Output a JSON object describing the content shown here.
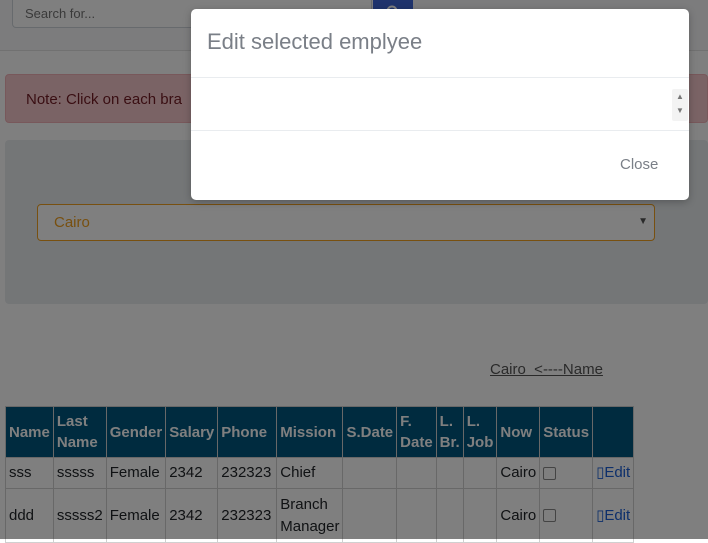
{
  "search": {
    "placeholder": "Search for..."
  },
  "note": {
    "text": "Note: Click on each bra"
  },
  "branch_select": {
    "value": "Cairo"
  },
  "branch_link": {
    "text": "Cairo  <----Name"
  },
  "table": {
    "headers": [
      {
        "label": "Name"
      },
      {
        "label": "Last Name"
      },
      {
        "label": "Gender"
      },
      {
        "label": "Salary"
      },
      {
        "label": "Phone"
      },
      {
        "label": "Mission"
      },
      {
        "label": "S.Date"
      },
      {
        "label": "F. Date"
      },
      {
        "label": "L. Br."
      },
      {
        "label": "L. Job"
      },
      {
        "label": "Now"
      },
      {
        "label": "Status"
      },
      {
        "label": ""
      }
    ],
    "rows": [
      {
        "name": "sss",
        "last": "sssss",
        "gender": "Female",
        "salary": "2342",
        "phone": "232323",
        "mission": "Chief",
        "now": "Cairo",
        "edit": "Edit"
      },
      {
        "name": "ddd",
        "last": "sssss2",
        "gender": "Female",
        "salary": "2342",
        "phone": "232323",
        "mission": "Branch Manager",
        "now": "Cairo",
        "edit": "Edit"
      }
    ]
  },
  "modal": {
    "title": "Edit selected emplyee",
    "close_label": "Close"
  },
  "colors": {
    "header_bg": "#00567f",
    "accent": "#f0a020",
    "search_button": "#3f67d8",
    "note_bg": "#f5c6cb"
  },
  "icons": {
    "search_button": "search-icon",
    "edit": "edit-icon"
  }
}
